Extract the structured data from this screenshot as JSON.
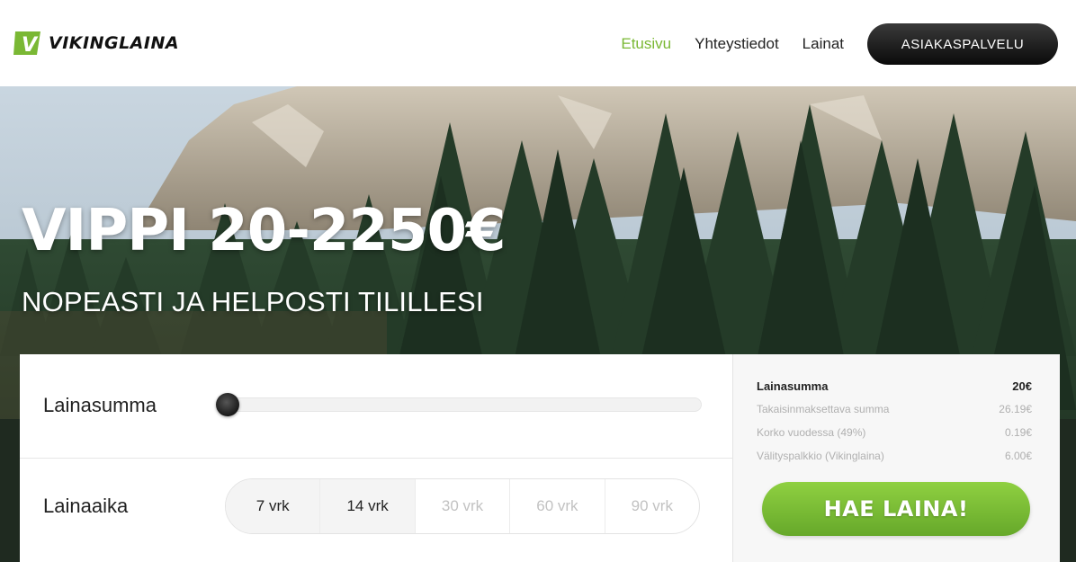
{
  "header": {
    "logo_letter": "V",
    "logo_text": "VIKINGLAINA",
    "nav": [
      {
        "label": "Etusivu",
        "active": true
      },
      {
        "label": "Yhteystiedot",
        "active": false
      },
      {
        "label": "Lainat",
        "active": false
      }
    ],
    "cta_label": "ASIAKASPALVELU"
  },
  "hero": {
    "title": "VIPPI 20-2250€",
    "subtitle": "NOPEASTI JA HELPOSTI TILILLESI"
  },
  "calculator": {
    "amount_label": "Lainasumma",
    "amount_slider_fraction": 0,
    "term_label": "Lainaaika",
    "term_options": [
      {
        "label": "7 vrk",
        "enabled": true
      },
      {
        "label": "14 vrk",
        "enabled": true
      },
      {
        "label": "30 vrk",
        "enabled": false
      },
      {
        "label": "60 vrk",
        "enabled": false
      },
      {
        "label": "90 vrk",
        "enabled": false
      }
    ]
  },
  "summary": {
    "loan_amount_label": "Lainasumma",
    "loan_amount_value": "20€",
    "repay_label": "Takaisinmaksettava summa",
    "repay_value": "26.19€",
    "interest_label": "Korko vuodessa (49%)",
    "interest_value": "0.19€",
    "fee_label": "Välityspalkkio (Vikinglaina)",
    "fee_value": "6.00€",
    "apply_label": "HAE LAINA!"
  },
  "colors": {
    "accent_green": "#7ab834",
    "button_dark": "#111111"
  }
}
